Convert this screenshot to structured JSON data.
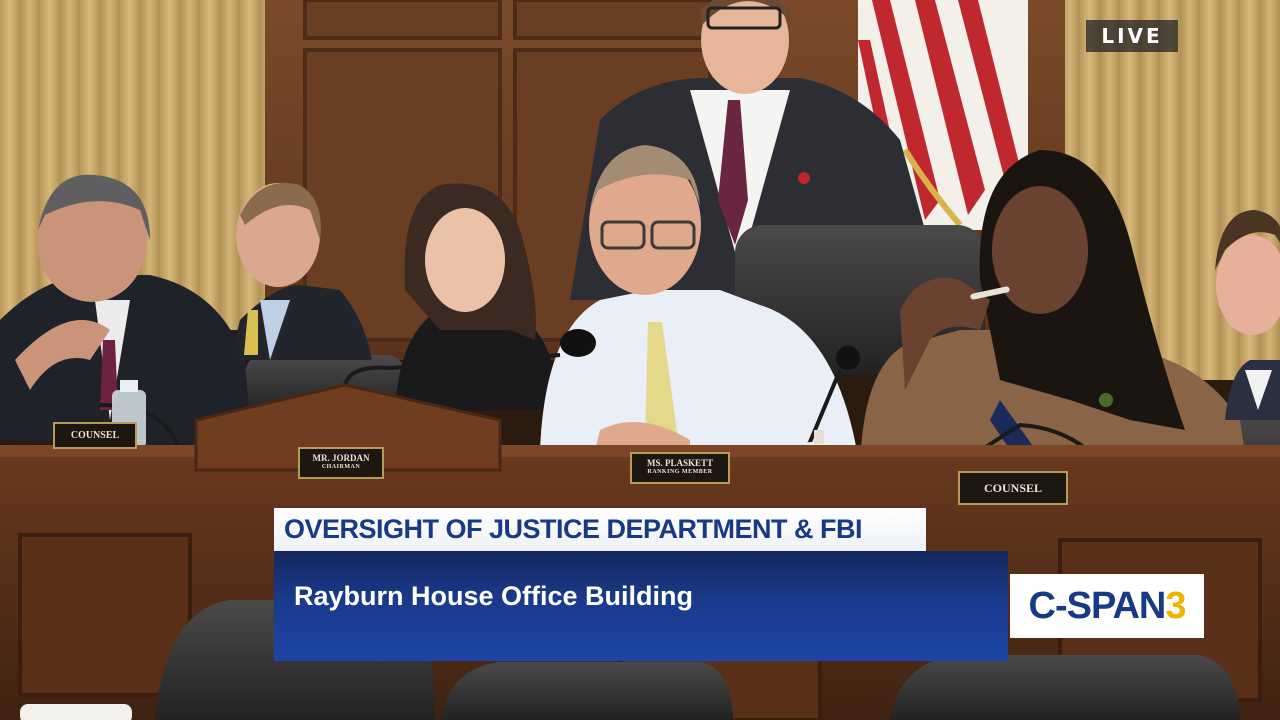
{
  "live_badge": "LIVE",
  "placards": {
    "counsel_left": "COUNSEL",
    "jordan_name": "MR. JORDAN",
    "jordan_role": "CHAIRMAN",
    "plaskett_name": "MS. PLASKETT",
    "plaskett_role": "RANKING MEMBER",
    "counsel_right": "COUNSEL"
  },
  "lower_third": {
    "title": "OVERSIGHT OF JUSTICE DEPARTMENT & FBI",
    "location": "Rayburn House Office Building"
  },
  "network_logo": {
    "text": "C-SPAN",
    "number": "3",
    "text_color": "#173a86",
    "number_color": "#f0b400"
  },
  "colors": {
    "title_bar_text": "#173a86",
    "location_bar": "#1a3a8c",
    "wood_paneling": "#6e4226",
    "curtain": "#c9a96a"
  }
}
